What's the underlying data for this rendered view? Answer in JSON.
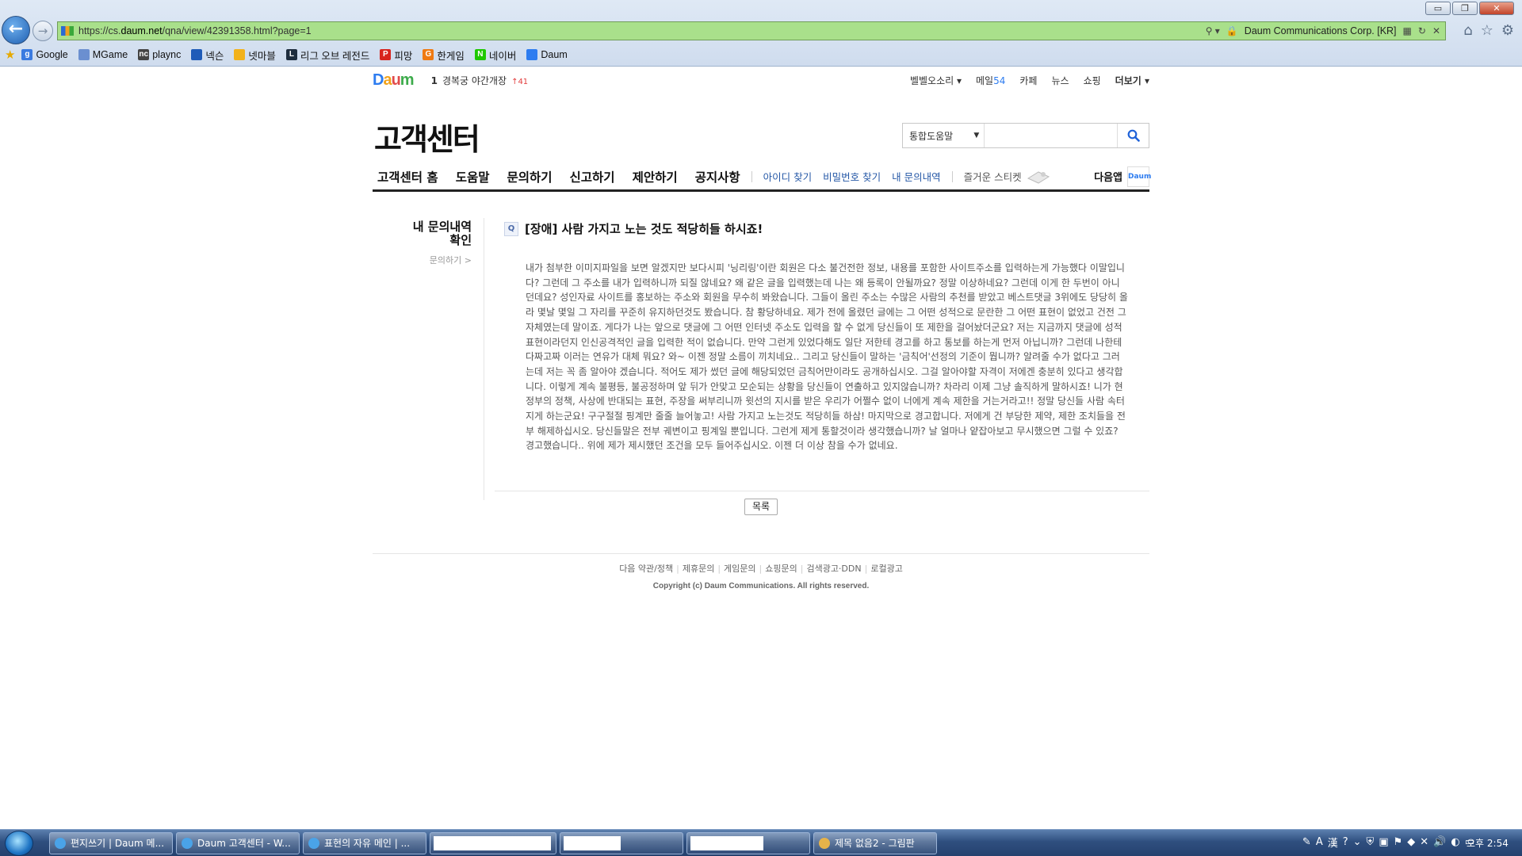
{
  "browser": {
    "url_prefix": "https://cs.",
    "url_domain": "daum.net",
    "url_path": "/qna/view/42391358.html?page=1",
    "site_identity": "Daum Communications Corp. [KR]",
    "window_buttons": {
      "minimize": "▭",
      "restore": "❐",
      "close": "✕"
    }
  },
  "bookmarks": [
    {
      "label": "Google",
      "icon": "google-icon",
      "color": "#3b7be0",
      "glyph": "g"
    },
    {
      "label": "MGame",
      "icon": "page-icon",
      "color": "#6b8fd0",
      "glyph": ""
    },
    {
      "label": "plaync",
      "icon": "plaync-icon",
      "color": "#444444",
      "glyph": "nc"
    },
    {
      "label": "넥슨",
      "icon": "nexon-icon",
      "color": "#1e5bb8",
      "glyph": ""
    },
    {
      "label": "넷마블",
      "icon": "netmarble-icon",
      "color": "#f2b21b",
      "glyph": ""
    },
    {
      "label": "리그 오브 레전드",
      "icon": "lol-icon",
      "color": "#1d2c3d",
      "glyph": "L"
    },
    {
      "label": "피망",
      "icon": "pmang-icon",
      "color": "#d8241d",
      "glyph": "P"
    },
    {
      "label": "한게임",
      "icon": "hangame-icon",
      "color": "#ef7a12",
      "glyph": "G"
    },
    {
      "label": "네이버",
      "icon": "naver-icon",
      "color": "#1ec800",
      "glyph": "N"
    },
    {
      "label": "Daum",
      "icon": "daum-icon",
      "color": "#2d7cf0",
      "glyph": ""
    }
  ],
  "gnb": {
    "logo": {
      "d1": "D",
      "d2": "a",
      "d3": "u",
      "d4": "m"
    },
    "rank_num": "1",
    "rank_text": "경복궁 야간개장",
    "rank_change": "↑41",
    "links": {
      "bell": "벨벨오소리 ▾",
      "mail": "메일",
      "mail_count": "54",
      "cafe": "카페",
      "news": "뉴스",
      "shopping": "쇼핑",
      "more": "더보기 ▾"
    }
  },
  "header": {
    "title": "고객센터",
    "search_select": "통합도움말",
    "search_placeholder": ""
  },
  "menu": {
    "main": [
      "고객센터 홈",
      "도움말",
      "문의하기",
      "신고하기",
      "제안하기",
      "공지사항"
    ],
    "sub": [
      "아이디 찾기",
      "비밀번호 찾기",
      "내 문의내역"
    ],
    "fun": "즐거운 스티켓",
    "app": "다음앱",
    "app_badge": "Daum"
  },
  "side": {
    "title_line1": "내 문의내역",
    "title_line2": "확인",
    "link": "문의하기 >"
  },
  "article": {
    "badge": "Q",
    "title": "[장애] 사람 가지고 노는 것도 적당히들 하시죠!",
    "body": "내가 첨부한 이미지파일을 보면 알겠지만 보다시피 '닝리링'이란 회원은 다소 불건전한 정보, 내용를 포함한 사이트주소를 입력하는게 가능했다 이말입니다? 그런데 그 주소를 내가 입력하니까 되질 않네요? 왜 같은 글을 입력했는데 나는 왜 등록이 안될까요? 정말 이상하네요? 그런데 이게 한 두번이 아니던데요? 성인자료 사이트를 홍보하는 주소와 회원을 무수히 봐왔습니다. 그들이 올린 주소는 수많은 사람의 추천를 받았고 베스트댓글 3위에도 당당히 올라 몇날 몇일 그 자리를 꾸준히 유지하던것도 봤습니다. 참 황당하네요. 제가 전에 올렸던 글에는 그 어떤 성적으로 문란한 그 어떤 표현이 없었고 건전 그 자체였는데 말이죠. 게다가 나는 앞으로 댓글에 그 어떤 인터넷 주소도 입력을 할 수 없게 당신들이 또 제한을 걸어놨더군요? 저는 지금까지 댓글에 성적표현이라던지 인신공격적인 글을 입력한 적이 없습니다. 만약 그런게 있었다해도 일단 저한테 경고를 하고 통보를 하는게 먼저 아닙니까? 그런데 나한테 다짜고짜 이러는 연유가 대체 뭐요? 와~ 이젠 정말 소름이 끼치네요.. 그리고 당신들이 말하는 '금칙어'선정의 기준이 뭡니까? 알려줄 수가 없다고 그러는데 저는 꼭 좀 알아야 겠습니다. 적어도 제가 썼던 글에 해당되었던 금칙어만이라도 공개하십시오. 그걸 알아야할 자격이 저에겐 충분히 있다고 생각합니다. 이렇게 계속 불평등, 불공정하며 앞 뒤가 안맞고 모순되는 상황을 당신들이 연출하고 있지않습니까? 차라리 이제 그냥 솔직하게 말하시죠! 니가 현 정부의 정책, 사상에 반대되는 표현, 주장을 써부리니까 윗선의 지시를 받은 우리가 어쩔수 없이 너에게 계속 제한을 거는거라고!! 정말 당신들 사람 속터지게 하는군요! 구구절절 핑계만 줄줄 늘어놓고! 사람 가지고 노는것도 적당히들 하삼! 마지막으로 경고합니다. 저에게 건 부당한 제약, 제한 조치들을 전부 해제하십시오. 당신들말은 전부 궤변이고 핑계일 뿐입니다. 그런게 제게 통할것이라 생각했습니까? 날 얼마나 얕잡아보고 무시했으면 그럴 수 있죠? 경고했습니다.. 위에 제가 제시했던 조건을 모두 들어주십시오. 이젠 더 이상 참을 수가 없네요.",
    "list_button": "목록"
  },
  "footer": {
    "links": [
      "다음 약관/정책",
      "제휴문의",
      "게임문의",
      "쇼핑문의",
      "검색광고·DDN",
      "로컬광고"
    ],
    "copyright": "Copyright (c) Daum Communications. All rights reserved."
  },
  "taskbar": {
    "tasks": [
      "편지쓰기 | Daum 메...",
      "Daum 고객센터 - W...",
      "표현의 자유 메인 | ...",
      "제목 없음2 - 그림판"
    ],
    "clock": "오후 2:54"
  },
  "colors": {
    "accent": "#2457a6",
    "address_bar": "#a9e08b"
  }
}
